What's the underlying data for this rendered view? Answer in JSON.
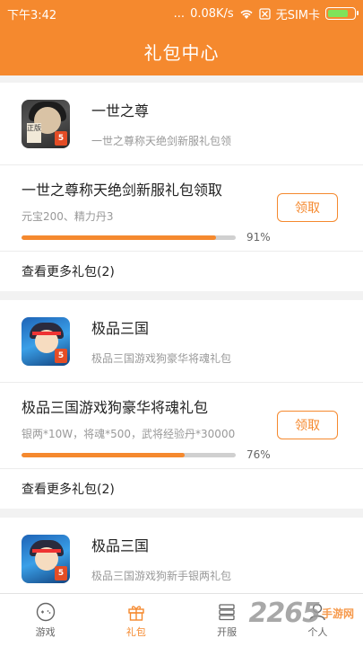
{
  "status_bar": {
    "time": "下午3:42",
    "dots": "...",
    "speed": "0.08K/s",
    "sim": "无SIM卡",
    "battery_level": 0.7
  },
  "header": {
    "title": "礼包中心"
  },
  "cards": [
    {
      "game_name": "一世之尊",
      "game_sub": "一世之尊称天绝剑新服礼包领",
      "icon_stamp": "正版",
      "gift_title": "一世之尊称天绝剑新服礼包领取",
      "gift_desc": "元宝200、精力丹3",
      "progress": 0.91,
      "progress_label": "91%",
      "claim_label": "领取",
      "more_label": "查看更多礼包(2)"
    },
    {
      "game_name": "极品三国",
      "game_sub": "极品三国游戏狗豪华将魂礼包",
      "gift_title": "极品三国游戏狗豪华将魂礼包",
      "gift_desc": "银两*10W，将魂*500，武将经验丹*30000",
      "progress": 0.76,
      "progress_label": "76%",
      "claim_label": "领取",
      "more_label": "查看更多礼包(2)"
    },
    {
      "game_name": "极品三国",
      "game_sub": "极品三国游戏狗新手银两礼包"
    }
  ],
  "tabs": [
    {
      "label": "游戏",
      "icon": "gamepad-icon",
      "active": false
    },
    {
      "label": "礼包",
      "icon": "gift-icon",
      "active": true
    },
    {
      "label": "开服",
      "icon": "server-list-icon",
      "active": false
    },
    {
      "label": "个人",
      "icon": "user-icon",
      "active": false
    }
  ],
  "watermark": {
    "number": "2265",
    "text": "手游网"
  },
  "colors": {
    "accent": "#f5892e",
    "battery": "#7fe35a"
  }
}
